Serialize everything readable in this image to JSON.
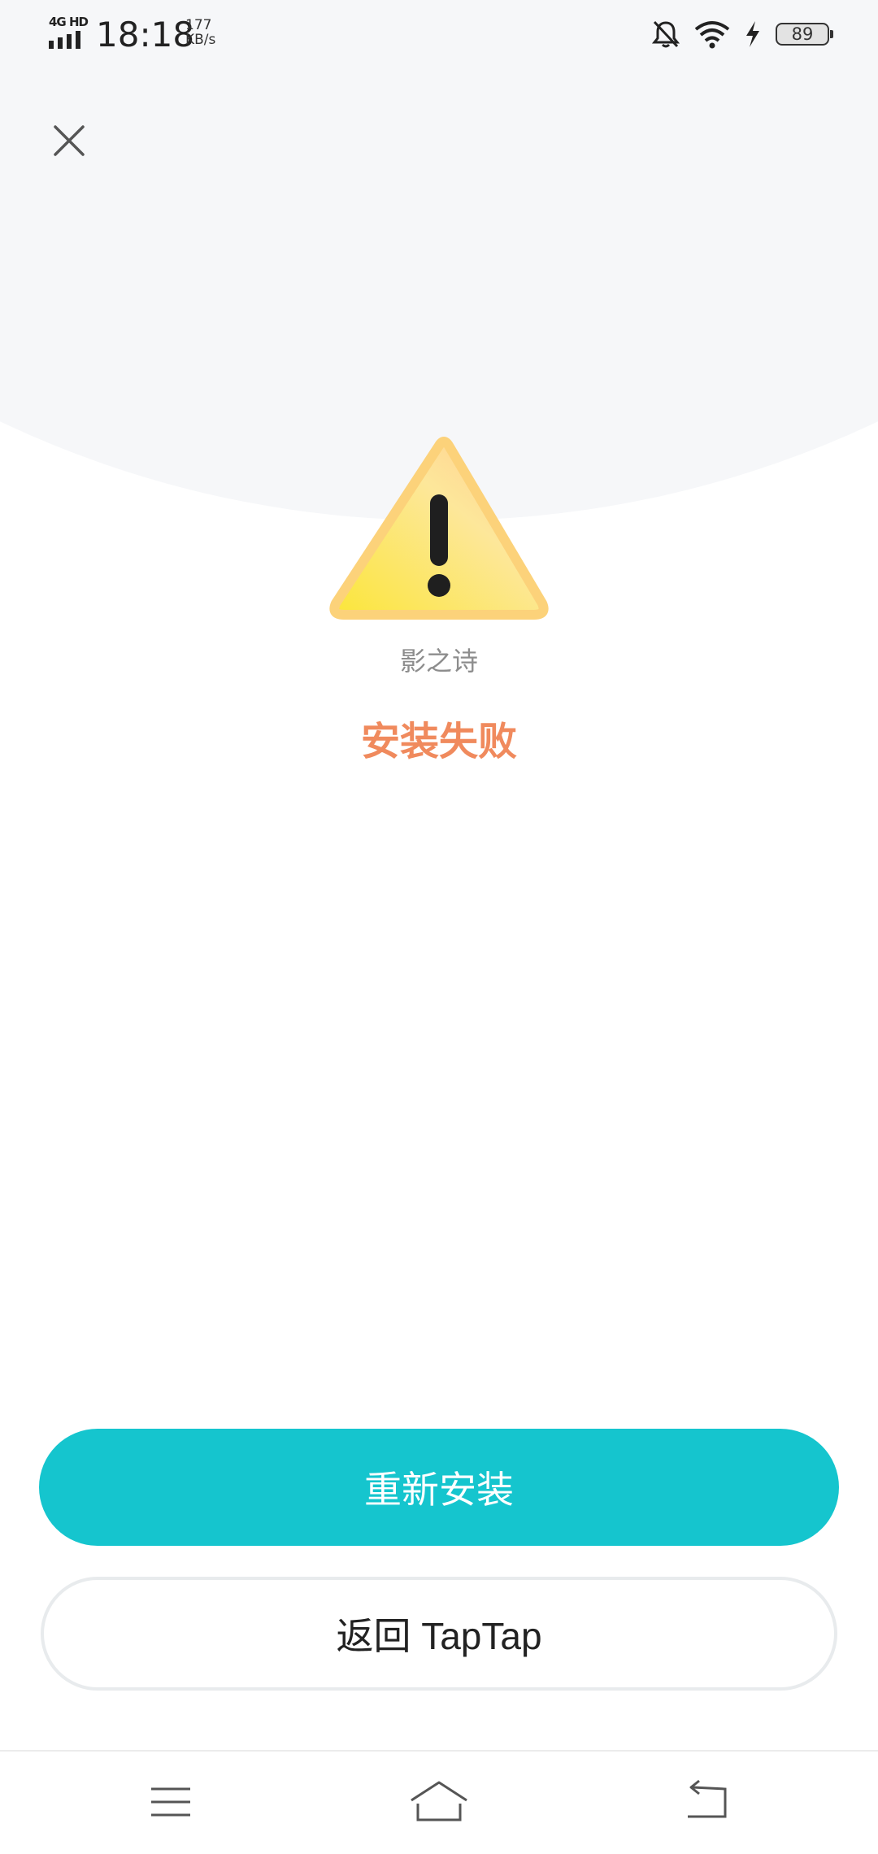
{
  "status_bar": {
    "network": "4G HD",
    "time": "18:18",
    "speed_value": "177",
    "speed_unit": "KB/s",
    "battery": "89",
    "icons": [
      "mute-bell-icon",
      "wifi-icon",
      "charging-bolt-icon",
      "battery-icon"
    ]
  },
  "header": {
    "close_icon": "close-icon"
  },
  "result": {
    "icon": "warning-icon",
    "app_name": "影之诗",
    "status": "安装失败",
    "status_color": "#f08a5d"
  },
  "actions": {
    "reinstall_label": "重新安装",
    "reinstall_color": "#15c5ce",
    "back_label": "返回 TapTap"
  },
  "nav_bar": {
    "items": [
      "menu-icon",
      "home-icon",
      "back-icon"
    ]
  }
}
